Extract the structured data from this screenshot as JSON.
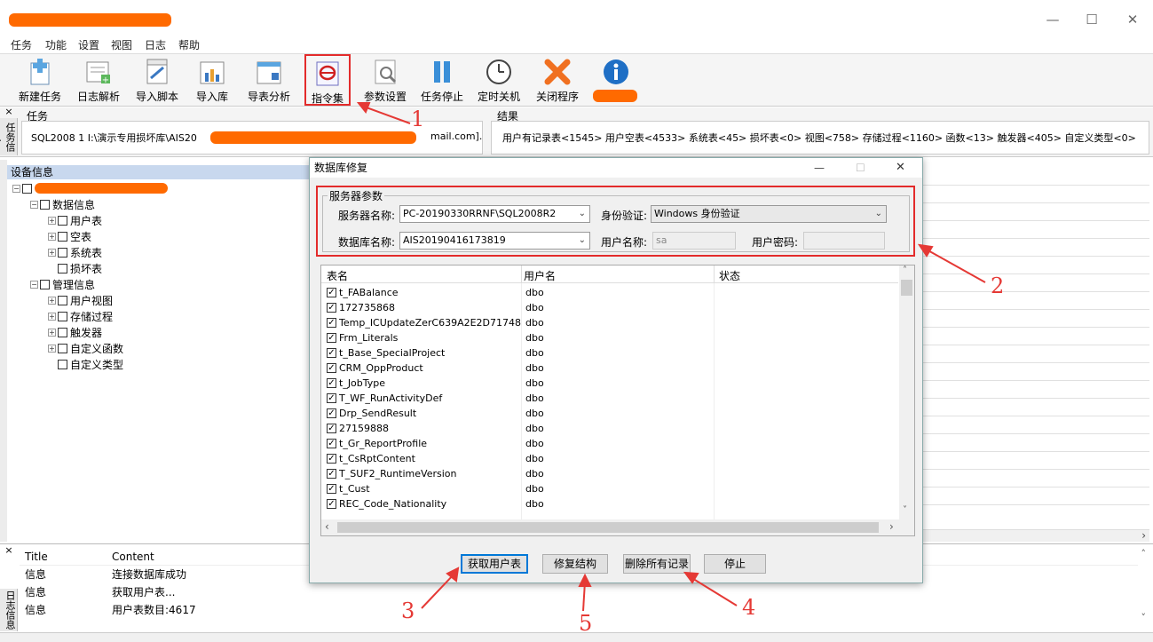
{
  "window": {
    "controls": {
      "minimize": "—",
      "maximize": "☐",
      "close": "✕"
    }
  },
  "menu": [
    "任务",
    "功能",
    "设置",
    "视图",
    "日志",
    "帮助"
  ],
  "toolbar": {
    "buttons": [
      {
        "label": "新建任务",
        "icon": "new-task-icon"
      },
      {
        "label": "日志解析",
        "icon": "log-parse-icon"
      },
      {
        "label": "导入脚本",
        "icon": "import-script-icon"
      },
      {
        "label": "导入库",
        "icon": "import-db-icon"
      },
      {
        "label": "导表分析",
        "icon": "table-analysis-icon"
      },
      {
        "label": "指令集",
        "icon": "command-set-icon"
      },
      {
        "label": "参数设置",
        "icon": "settings-icon"
      },
      {
        "label": "任务停止",
        "icon": "pause-icon"
      },
      {
        "label": "定时关机",
        "icon": "clock-icon"
      },
      {
        "label": "关闭程序",
        "icon": "close-program-icon"
      },
      {
        "label": "",
        "icon": "info-icon"
      }
    ]
  },
  "task_panel": {
    "side_tab": "任务信息",
    "task_header": "任务",
    "task_text_prefix": "SQL2008 1 I:\\演示专用损坏库\\AIS20",
    "task_text_suffix": "mail.com].",
    "result_header": "结果",
    "result_text": "用户有记录表<1545> 用户空表<4533> 系统表<45> 损坏表<0> 视图<758> 存储过程<1160> 函数<13> 触发器<405> 自定义类型<0>"
  },
  "device_tree": {
    "header": "设备信息",
    "nodes": {
      "data_info": "数据信息",
      "user_tables": "用户表",
      "empty_tables": "空表",
      "system_tables": "系统表",
      "damaged_tables": "损坏表",
      "manage_info": "管理信息",
      "user_views": "用户视图",
      "stored_procs": "存储过程",
      "triggers": "触发器",
      "custom_funcs": "自定义函数",
      "custom_types": "自定义类型"
    }
  },
  "log_panel": {
    "side_tab": "日志信息",
    "col_title": "Title",
    "col_content": "Content",
    "rows": [
      {
        "title": "信息",
        "content": "连接数据库成功"
      },
      {
        "title": "信息",
        "content": "获取用户表..."
      },
      {
        "title": "信息",
        "content": "用户表数目:4617"
      }
    ]
  },
  "dialog": {
    "title": "数据库修复",
    "controls": {
      "minimize": "—",
      "maximize": "☐",
      "close": "✕"
    },
    "server_group": "服务器参数",
    "server_name_label": "服务器名称:",
    "server_name_value": "PC-20190330RRNF\\SQL2008R2",
    "auth_label": "身份验证:",
    "auth_value": "Windows 身份验证",
    "db_name_label": "数据库名称:",
    "db_name_value": "AIS20190416173819",
    "user_label": "用户名称:",
    "user_value": "sa",
    "password_label": "用户密码:",
    "columns": [
      "表名",
      "用户名",
      "状态"
    ],
    "rows": [
      {
        "name": "t_FABalance",
        "user": "dbo"
      },
      {
        "name": "172735868",
        "user": "dbo"
      },
      {
        "name": "Temp_ICUpdateZerC639A2E2D71748...",
        "user": "dbo"
      },
      {
        "name": "Frm_Literals",
        "user": "dbo"
      },
      {
        "name": "t_Base_SpecialProject",
        "user": "dbo"
      },
      {
        "name": "CRM_OppProduct",
        "user": "dbo"
      },
      {
        "name": "t_JobType",
        "user": "dbo"
      },
      {
        "name": "T_WF_RunActivityDef",
        "user": "dbo"
      },
      {
        "name": "Drp_SendResult",
        "user": "dbo"
      },
      {
        "name": "27159888",
        "user": "dbo"
      },
      {
        "name": "t_Gr_ReportProfile",
        "user": "dbo"
      },
      {
        "name": "t_CsRptContent",
        "user": "dbo"
      },
      {
        "name": "T_SUF2_RuntimeVersion",
        "user": "dbo"
      },
      {
        "name": "t_Cust",
        "user": "dbo"
      },
      {
        "name": "REC_Code_Nationality",
        "user": "dbo"
      }
    ],
    "buttons": {
      "get_tables": "获取用户表",
      "repair": "修复结构",
      "delete_all": "删除所有记录",
      "stop": "停止"
    }
  },
  "annotations": [
    "1",
    "2",
    "3",
    "4",
    "5"
  ],
  "colors": {
    "annotation": "#e53935",
    "highlight": "#e32b2b",
    "redaction": "#ff6a00",
    "tree_header": "#c8d8ee"
  }
}
